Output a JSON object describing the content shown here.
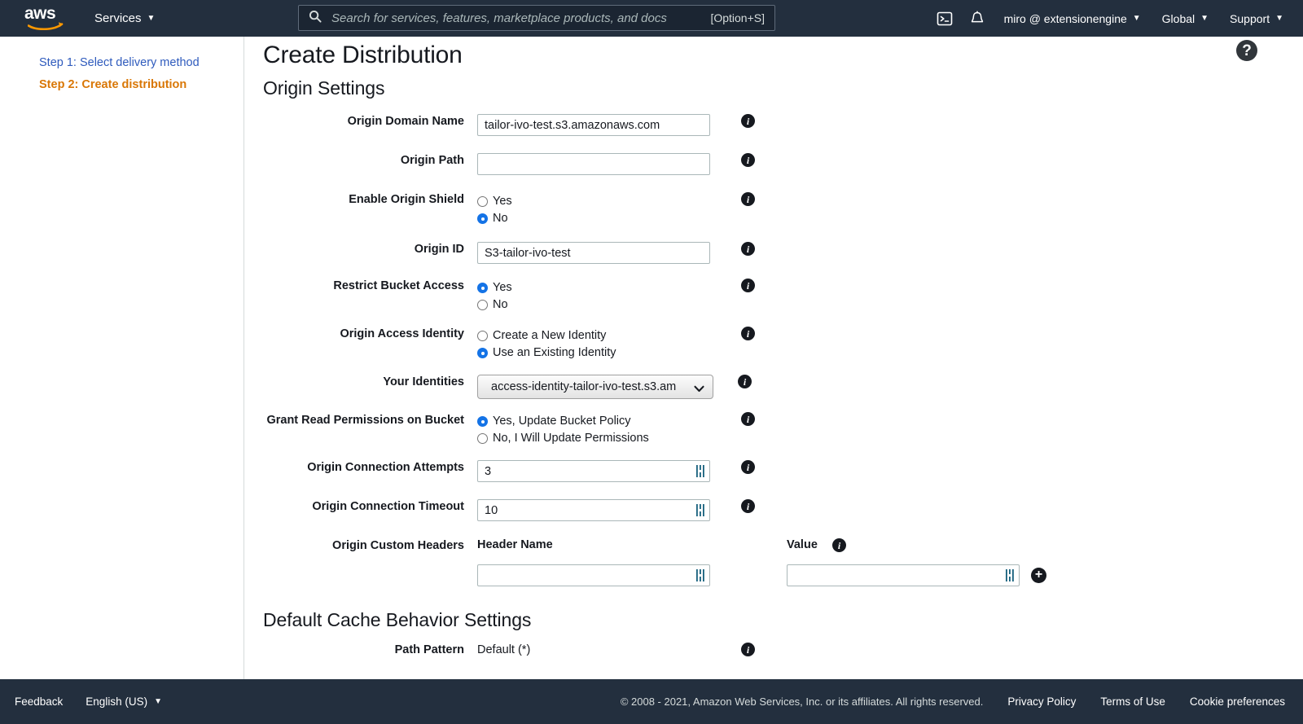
{
  "topnav": {
    "logo_alt": "aws",
    "services_label": "Services",
    "search": {
      "placeholder": "Search for services, features, marketplace products, and docs",
      "value": "",
      "shortcut": "[Option+S]"
    },
    "cloudshell_icon": "cloudshell-icon",
    "bell_icon": "notifications-bell-icon",
    "account_label": "miro @ extensionengine",
    "region_label": "Global",
    "support_label": "Support"
  },
  "sidebar": {
    "steps": [
      {
        "label": "Step 1: Select delivery method",
        "state": "completed"
      },
      {
        "label": "Step 2: Create distribution",
        "state": "current"
      }
    ]
  },
  "main": {
    "page_title": "Create Distribution",
    "help_button_label": "?",
    "origin_section_title": "Origin Settings",
    "cache_section_title": "Default Cache Behavior Settings",
    "fields": {
      "origin_domain_name": {
        "label": "Origin Domain Name",
        "value": "tailor-ivo-test.s3.amazonaws.com",
        "placeholder": ""
      },
      "origin_path": {
        "label": "Origin Path",
        "value": "",
        "placeholder": ""
      },
      "enable_origin_shield": {
        "label": "Enable Origin Shield",
        "options": [
          "Yes",
          "No"
        ],
        "selected": "No"
      },
      "origin_id": {
        "label": "Origin ID",
        "value": "S3-tailor-ivo-test",
        "placeholder": ""
      },
      "restrict_bucket_access": {
        "label": "Restrict Bucket Access",
        "options": [
          "Yes",
          "No"
        ],
        "selected": "Yes"
      },
      "origin_access_identity": {
        "label": "Origin Access Identity",
        "options": [
          "Create a New Identity",
          "Use an Existing Identity"
        ],
        "selected": "Use an Existing Identity"
      },
      "your_identities": {
        "label": "Your Identities",
        "selected": "access-identity-tailor-ivo-test.s3.am",
        "options": [
          "access-identity-tailor-ivo-test.s3.am"
        ]
      },
      "grant_read_permissions": {
        "label": "Grant Read Permissions on Bucket",
        "options": [
          "Yes, Update Bucket Policy",
          "No, I Will Update Permissions"
        ],
        "selected": "Yes, Update Bucket Policy"
      },
      "origin_connection_attempts": {
        "label": "Origin Connection Attempts",
        "value": "3",
        "placeholder": ""
      },
      "origin_connection_timeout": {
        "label": "Origin Connection Timeout",
        "value": "10",
        "placeholder": ""
      },
      "origin_custom_headers": {
        "label": "Origin Custom Headers",
        "header_name_column": "Header Name",
        "value_column": "Value",
        "header_name_value": "",
        "header_value_value": "",
        "add_button_label": "+"
      },
      "path_pattern": {
        "label": "Path Pattern",
        "value": "Default (*)"
      }
    },
    "info_icon_label": "i"
  },
  "footer": {
    "feedback_label": "Feedback",
    "language_label": "English (US)",
    "copyright": "© 2008 - 2021, Amazon Web Services, Inc. or its affiliates. All rights reserved.",
    "privacy_policy_label": "Privacy Policy",
    "terms_label": "Terms of Use",
    "cookie_label": "Cookie preferences"
  }
}
